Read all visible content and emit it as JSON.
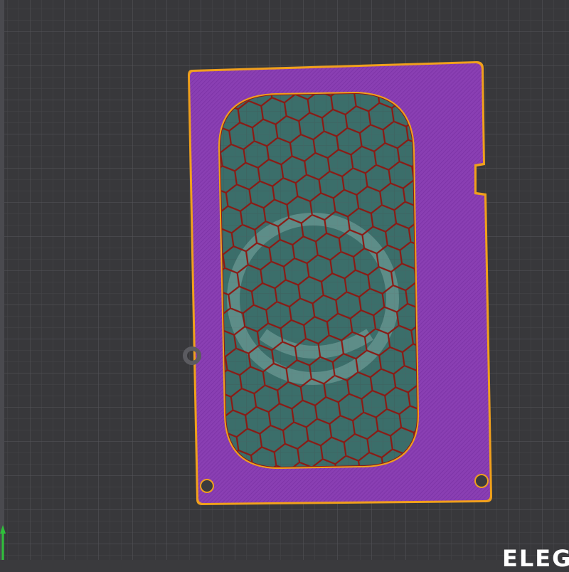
{
  "viewport": {
    "bed_label": "ELEG",
    "colors": {
      "background": "#3a3a3d",
      "grid_major": "#55555a",
      "grid_minor": "#46464a",
      "part_fill": "#8a3fb3",
      "part_hatch": "#7a31a4",
      "outline": "#f0a01c",
      "window_fill": "#3b6e6a",
      "honeycomb_stroke": "#8b1a14",
      "axis_y": "#2fbf3a",
      "bed_logo": "#9fc8c0"
    },
    "part": {
      "name": "panel-with-honeycomb-window",
      "mounting_holes": 2,
      "edge_notch": true
    }
  }
}
